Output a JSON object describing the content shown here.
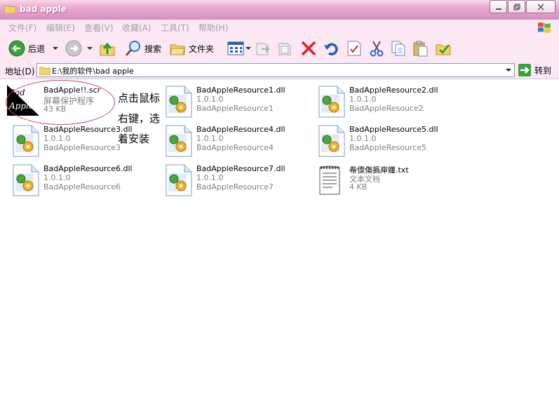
{
  "window": {
    "title": "bad apple"
  },
  "menu": [
    "文件(F)",
    "编辑(E)",
    "查看(V)",
    "收藏(A)",
    "工具(T)",
    "帮助(H)"
  ],
  "toolbar": {
    "back_label": "后退",
    "search_label": "搜索",
    "folders_label": "文件夹"
  },
  "address": {
    "label": "地址(D)",
    "path": "E:\\我的软件\\bad apple",
    "go_label": "转到"
  },
  "annotation": [
    "点击鼠标",
    "右键，选",
    "着安装"
  ],
  "bad_icon_text": [
    "Bad",
    "Apple!!"
  ],
  "files": [
    {
      "name": "BadApple!!.scr",
      "line2": "屏幕保护程序",
      "line3": "43 KB"
    },
    {
      "name": "BadAppleResource1.dll",
      "line2": "1.0.1.0",
      "line3": "BadAppleResource1"
    },
    {
      "name": "BadAppleResource2.dll",
      "line2": "1.0.1.0",
      "line3": "BadAppleResouce2"
    },
    {
      "name": "BadAppleResource3.dll",
      "line2": "1.0.1.0",
      "line3": "BadAppleResource3"
    },
    {
      "name": "BadAppleResource4.dll",
      "line2": "1.0.1.0",
      "line3": "BadAppleResource4"
    },
    {
      "name": "BadAppleResource5.dll",
      "line2": "1.0.1.0",
      "line3": "BadAppleResource5"
    },
    {
      "name": "BadAppleResource6.dll",
      "line2": "1.0.1.0",
      "line3": "BadAppleResource6"
    },
    {
      "name": "BadAppleResource7.dll",
      "line2": "1.0.1.0",
      "line3": "BadAppleResource7"
    },
    {
      "name": "帣偄傷撝庘嫤.txt",
      "line2": "文本文档",
      "line3": "4 KB"
    }
  ],
  "colors": {
    "title_gradient": "#d88ec0",
    "menu_bg": "#fbe8f3",
    "annotation_ellipse": "#d4494e",
    "disabled_text": "#a2a2a2"
  }
}
